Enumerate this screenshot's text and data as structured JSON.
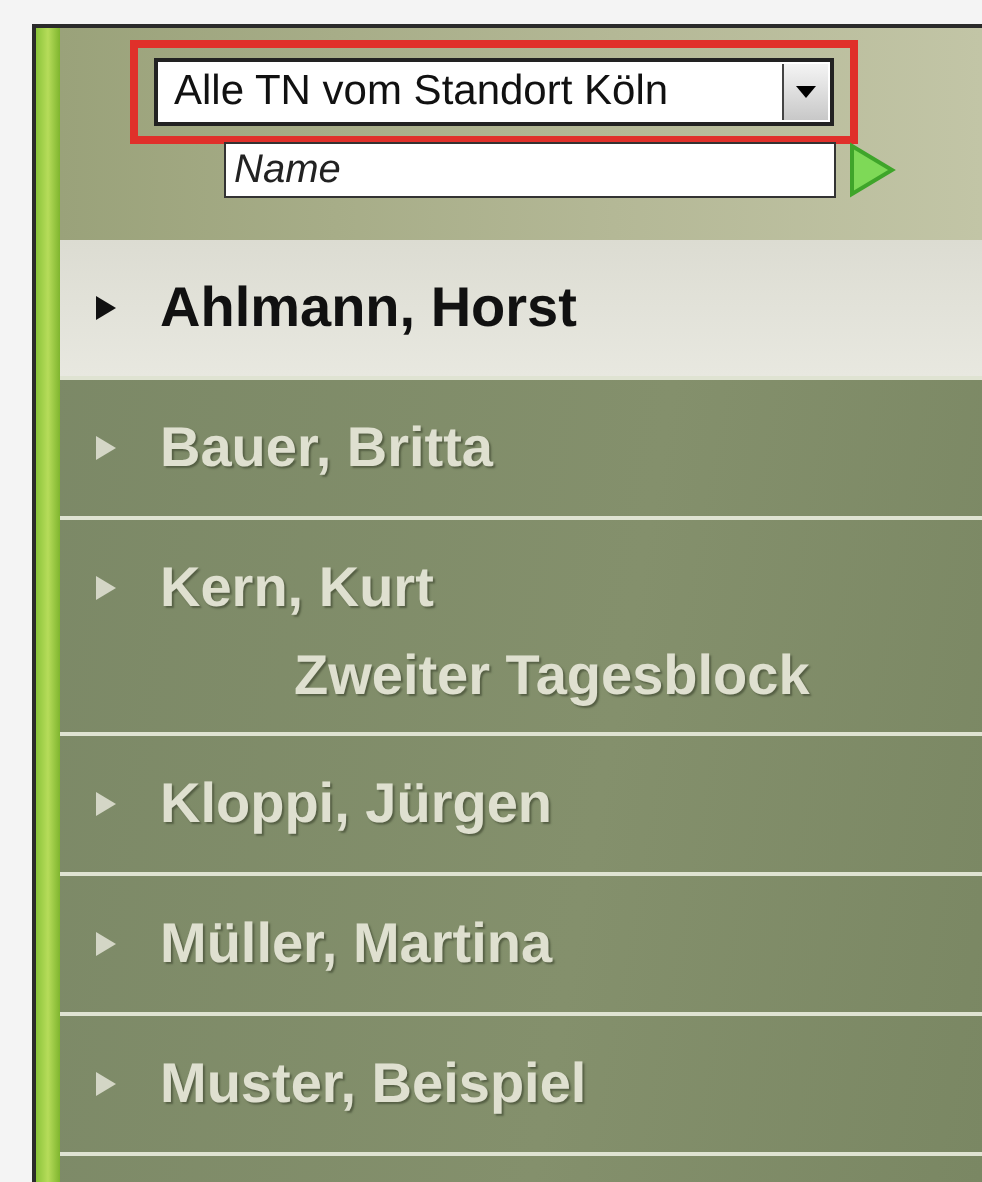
{
  "filter": {
    "value": "Alle TN vom Standort Köln",
    "highlighted": true
  },
  "search": {
    "placeholder": "Name"
  },
  "people": [
    {
      "name": "Ahlmann, Horst",
      "selected": true
    },
    {
      "name": "Bauer, Britta",
      "selected": false
    },
    {
      "name": "Kern, Kurt",
      "selected": false,
      "subtitle": "Zweiter Tagesblock"
    },
    {
      "name": "Kloppi, Jürgen",
      "selected": false
    },
    {
      "name": "Müller, Martina",
      "selected": false
    },
    {
      "name": "Muster, Beispiel",
      "selected": false
    }
  ]
}
